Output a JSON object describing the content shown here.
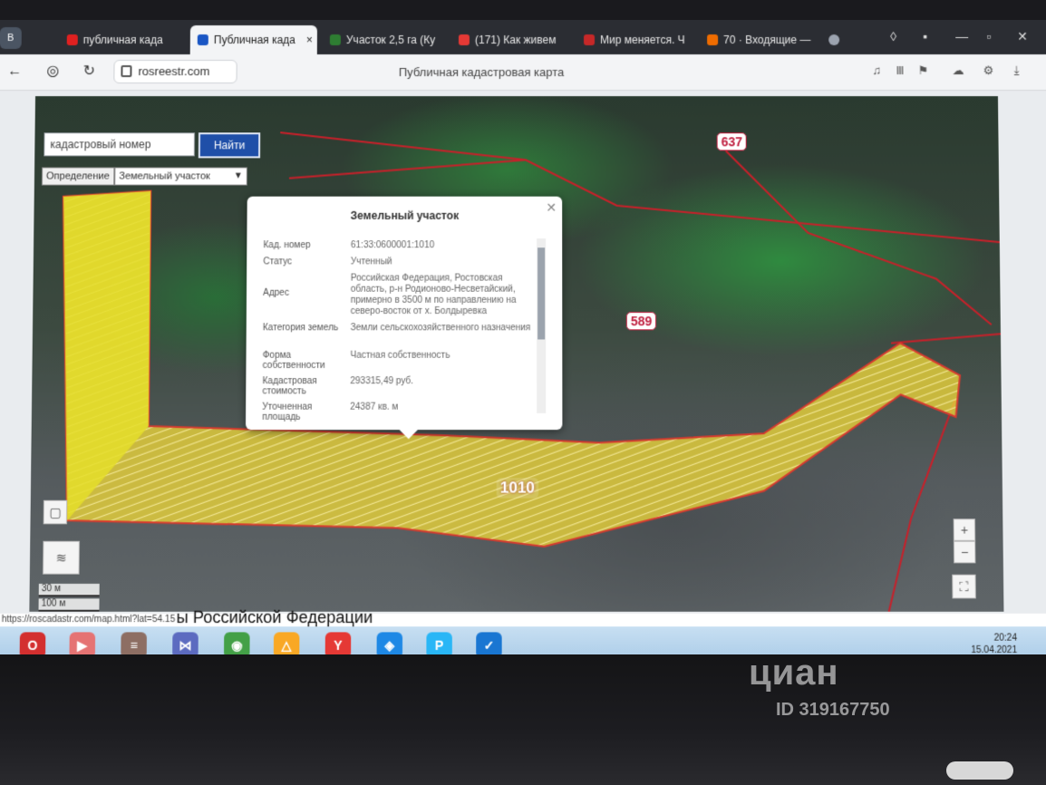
{
  "browser": {
    "sidebar_label": "В",
    "tabs": [
      {
        "label": "публичная када",
        "favicon_color": "#e02020",
        "active": false
      },
      {
        "label": "Публичная када",
        "favicon_color": "#1a56c4",
        "active": true
      },
      {
        "label": "Участок 2,5 га (Ку",
        "favicon_color": "#2e7d32",
        "active": false
      },
      {
        "label": "(171) Как живем",
        "favicon_color": "#e53935",
        "active": false
      },
      {
        "label": "Мир меняется. Ч",
        "favicon_color": "#c62828",
        "active": false
      },
      {
        "label": "70 · Входящие —",
        "favicon_color": "#ef6c00",
        "active": false
      }
    ],
    "close_glyph": "×",
    "url": "rosreestr.com",
    "page_title": "Публичная кадастровая карта"
  },
  "map": {
    "search_placeholder": "кадастровый номер",
    "search_button": "Найти",
    "define_label": "Определение",
    "define_select": "Земельный участок",
    "plot_labels": [
      "589",
      "1010",
      "637"
    ],
    "scale_labels": [
      "30 м",
      "100 м"
    ],
    "zoom_plus": "+",
    "zoom_minus": "−"
  },
  "popup": {
    "title": "Земельный участок",
    "rows": [
      {
        "key": "Кад. номер",
        "value": "61:33:0600001:1010"
      },
      {
        "key": "Статус",
        "value": "Учтенный"
      },
      {
        "key": "Адрес",
        "value": "Российская Федерация, Ростовская область, р-н Родионово-Несветайский, примерно в 3500 м по направлению на северо-восток от х. Болдыревка"
      },
      {
        "key": "Категория земель",
        "value": "Земли сельскохозяйственного назначения"
      },
      {
        "key": "Форма собственности",
        "value": "Частная собственность"
      },
      {
        "key": "Кадастровая стоимость",
        "value": "293315,49 руб."
      },
      {
        "key": "Уточненная площадь",
        "value": "24387 кв. м"
      }
    ]
  },
  "status": {
    "url_text": "https://roscadastr.com/map.html?lat=54.15",
    "rf_text": "ы Российской Федерации"
  },
  "taskbar": {
    "icons": [
      {
        "name": "opera-icon",
        "color": "#d32f2f",
        "glyph": "O"
      },
      {
        "name": "media-player-icon",
        "color": "#e57373",
        "glyph": "▶"
      },
      {
        "name": "book-icon",
        "color": "#8d6e63",
        "glyph": "≡"
      },
      {
        "name": "bowtie-app-icon",
        "color": "#5c6bc0",
        "glyph": "⋈"
      },
      {
        "name": "chrome-icon",
        "color": "#43a047",
        "glyph": "◉"
      },
      {
        "name": "triangle-app-icon",
        "color": "#f9a825",
        "glyph": "△"
      },
      {
        "name": "yandex-browser-icon",
        "color": "#e53935",
        "glyph": "Y"
      },
      {
        "name": "shield-app-icon",
        "color": "#1e88e5",
        "glyph": "◈"
      },
      {
        "name": "p-app-icon",
        "color": "#29b6f6",
        "glyph": "P"
      },
      {
        "name": "check-app-icon",
        "color": "#1976d2",
        "glyph": "✓"
      }
    ],
    "clock_time": "20:24",
    "clock_date": "15.04.2021"
  },
  "watermark": {
    "brand": "циан",
    "id": "ID 319167750"
  },
  "colors": {
    "plot_fill": "#e8d23a",
    "plot_border": "#d63b2f",
    "boundary": "#c8202a",
    "search_button": "#1f4fa8"
  }
}
